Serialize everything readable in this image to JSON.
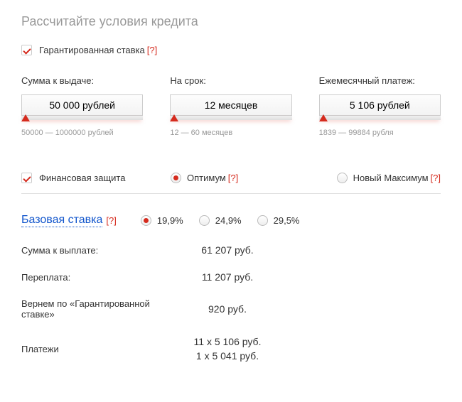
{
  "title": "Рассчитайте условия кредита",
  "guaranteed": {
    "label": "Гарантированная ставка",
    "help": "[?]"
  },
  "sliders": {
    "amount": {
      "label": "Сумма к выдаче:",
      "value": "50 000 рублей",
      "range": "50000 — 1000000 рублей"
    },
    "term": {
      "label": "На срок:",
      "value": "12 месяцев",
      "range": "12 — 60 месяцев"
    },
    "payment": {
      "label": "Ежемесячный платеж:",
      "value": "5 106 рублей",
      "range": "1839 — 99884 рубля"
    }
  },
  "protection": {
    "label": "Финансовая защита",
    "opt1": "Оптимум",
    "opt1_help": "[?]",
    "opt2": "Новый Максимум",
    "opt2_help": "[?]"
  },
  "rate": {
    "label": "Базовая ставка",
    "help": "[?]",
    "o1": "19,9%",
    "o2": "24,9%",
    "o3": "29,5%"
  },
  "summary": {
    "total_label": "Сумма к выплате:",
    "total_value": "61 207 руб.",
    "over_label": "Переплата:",
    "over_value": "11 207 руб.",
    "refund_label": "Вернем по «Гарантированной ставке»",
    "refund_value": "920 руб.",
    "payments_label": "Платежи",
    "payments_v1": "11 x 5 106 руб.",
    "payments_v2": "1 x 5 041 руб."
  }
}
